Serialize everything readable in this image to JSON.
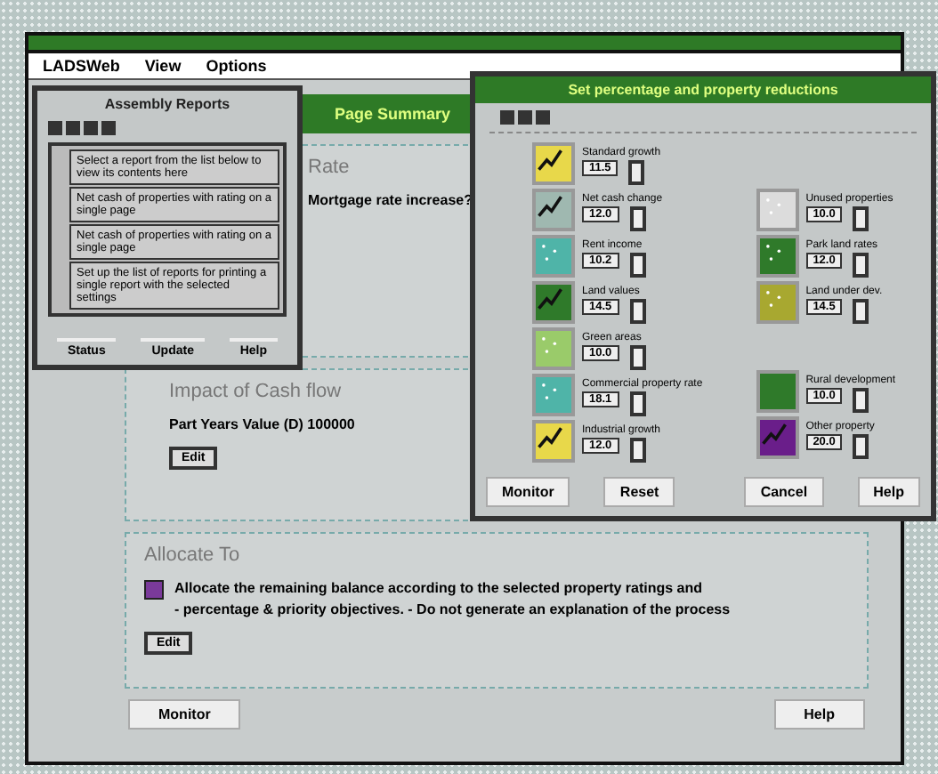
{
  "menu": [
    "LADSWeb",
    "View",
    "Options"
  ],
  "main": {
    "header": "Page Summary",
    "section_1": {
      "title": "Rate",
      "text": "Mortgage rate increase?"
    },
    "section_2": {
      "title": "Impact of Cash flow",
      "text": "Part Years Value (D)  100000",
      "button": "Edit"
    },
    "section_3": {
      "title": "Allocate To",
      "checked": true,
      "lines": [
        "Allocate the remaining balance according to the selected property ratings and",
        "- percentage & priority objectives. - Do not generate an explanation of the process"
      ],
      "button": "Edit"
    },
    "buttons": [
      "Monitor",
      "Help"
    ]
  },
  "reports": {
    "title": "Assembly Reports",
    "items": [
      {
        "text": "Select a report from the list below to view its contents here"
      },
      {
        "text": "Net cash of properties with rating on a single page"
      },
      {
        "text": "Net cash of properties with rating on a single page"
      },
      {
        "text": "Set up the list of reports for printing a single report with the selected settings"
      }
    ],
    "buttons": [
      "Status",
      "Update",
      "Help"
    ]
  },
  "reductions": {
    "title": "Set percentage and property reductions",
    "left": [
      {
        "label": "Standard growth",
        "value": "11.5",
        "color": "#e8d84a",
        "kind": "chart"
      },
      {
        "label": "Net cash change",
        "value": "12.0",
        "color": "#9fb8b0",
        "kind": "chart"
      },
      {
        "label": "Rent income",
        "value": "10.2",
        "color": "#4fb4a8",
        "kind": "dots"
      },
      {
        "label": "Land values",
        "value": "14.5",
        "color": "#2f7a2a",
        "kind": "chart"
      },
      {
        "label": "Green areas",
        "value": "10.0",
        "color": "#9acb6a",
        "kind": "dots"
      },
      {
        "label": "Commercial property rate",
        "value": "18.1",
        "color": "#4fb4a8",
        "kind": "dots"
      },
      {
        "label": "Industrial growth",
        "value": "12.0",
        "color": "#e8d84a",
        "kind": "chart"
      }
    ],
    "right": [
      {
        "label": "Unused properties",
        "value": "10.0",
        "color": "#dcdcdc",
        "kind": "dots"
      },
      {
        "label": "Park land rates",
        "value": "12.0",
        "color": "#2f7a2a",
        "kind": "dots"
      },
      {
        "label": "Land under dev.",
        "value": "14.5",
        "color": "#a8a830",
        "kind": "dots"
      },
      {
        "label": "Rural development",
        "value": "10.0",
        "color": "#2f7a2a",
        "kind": "plain"
      },
      {
        "label": "Other property",
        "value": "20.0",
        "color": "#6a1e8a",
        "kind": "chart"
      }
    ],
    "buttons": [
      "Monitor",
      "Reset",
      "Cancel",
      "Help"
    ]
  }
}
